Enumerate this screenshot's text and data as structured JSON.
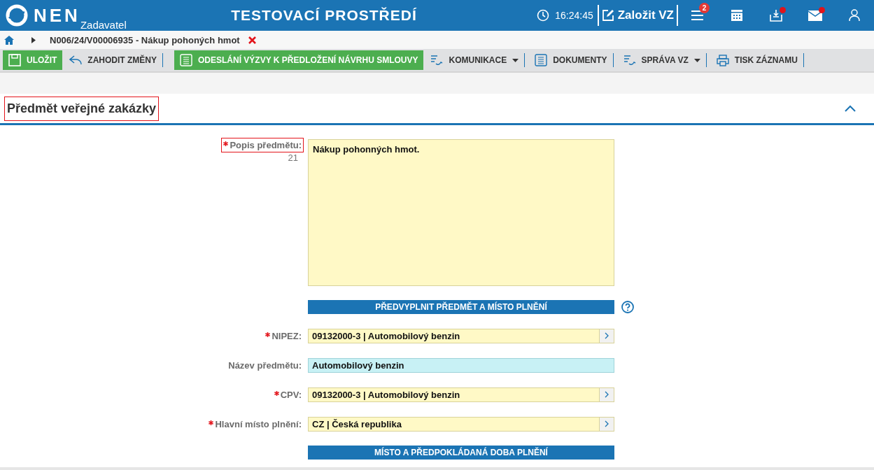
{
  "header": {
    "logo": "NEN",
    "logo_sub": "Zadavatel",
    "title": "TESTOVACÍ PROSTŘEDÍ",
    "time": "16:24:45",
    "create_label": "Založit VZ",
    "menu_badge": "2",
    "inbox_dot": true,
    "mail_dot": true
  },
  "breadcrumb": {
    "text": "N006/24/V00006935 - Nákup pohoných hmot"
  },
  "toolbar": [
    {
      "label": "ULOŽIT",
      "kind": "primary",
      "dropdown": false
    },
    {
      "label": "ZAHODIT ZMĚNY",
      "kind": "plain",
      "dropdown": false
    },
    {
      "label": "ODESLÁNÍ VÝZVY K PŘEDLOŽENÍ NÁVRHU SMLOUVY",
      "kind": "primary",
      "dropdown": false
    },
    {
      "label": "KOMUNIKACE",
      "kind": "plain",
      "dropdown": true
    },
    {
      "label": "DOKUMENTY",
      "kind": "plain",
      "dropdown": false
    },
    {
      "label": "SPRÁVA VZ",
      "kind": "plain",
      "dropdown": true
    },
    {
      "label": "TISK ZÁZNAMU",
      "kind": "plain",
      "dropdown": false
    }
  ],
  "section": {
    "title": "Předmět veřejné zakázky",
    "highlighted": true,
    "expanded": true
  },
  "form": [
    {
      "kind": "textarea",
      "label": "Popis předmětu:",
      "required": true,
      "highlighted": true,
      "counter": "21",
      "value": "Nákup pohonných hmot."
    },
    {
      "kind": "button",
      "label": "PŘEDVYPLNIT PŘEDMĚT A MÍSTO PLNĚNÍ",
      "help": true
    },
    {
      "kind": "lookup",
      "label": "NIPEZ:",
      "required": true,
      "highlighted": false,
      "value": "09132000-3 | Automobilový benzin"
    },
    {
      "kind": "text",
      "label": "Název předmětu:",
      "required": false,
      "highlighted": false,
      "value": "Automobilový benzin"
    },
    {
      "kind": "lookup",
      "label": "CPV:",
      "required": true,
      "highlighted": false,
      "value": "09132000-3 | Automobilový benzin"
    },
    {
      "kind": "lookup",
      "label": "Hlavní místo plnění:",
      "required": true,
      "highlighted": false,
      "value": "CZ | Česká republika"
    },
    {
      "kind": "button",
      "label": "MÍSTO A PŘEDPOKLÁDANÁ DOBA PLNĚNÍ",
      "help": false
    }
  ]
}
